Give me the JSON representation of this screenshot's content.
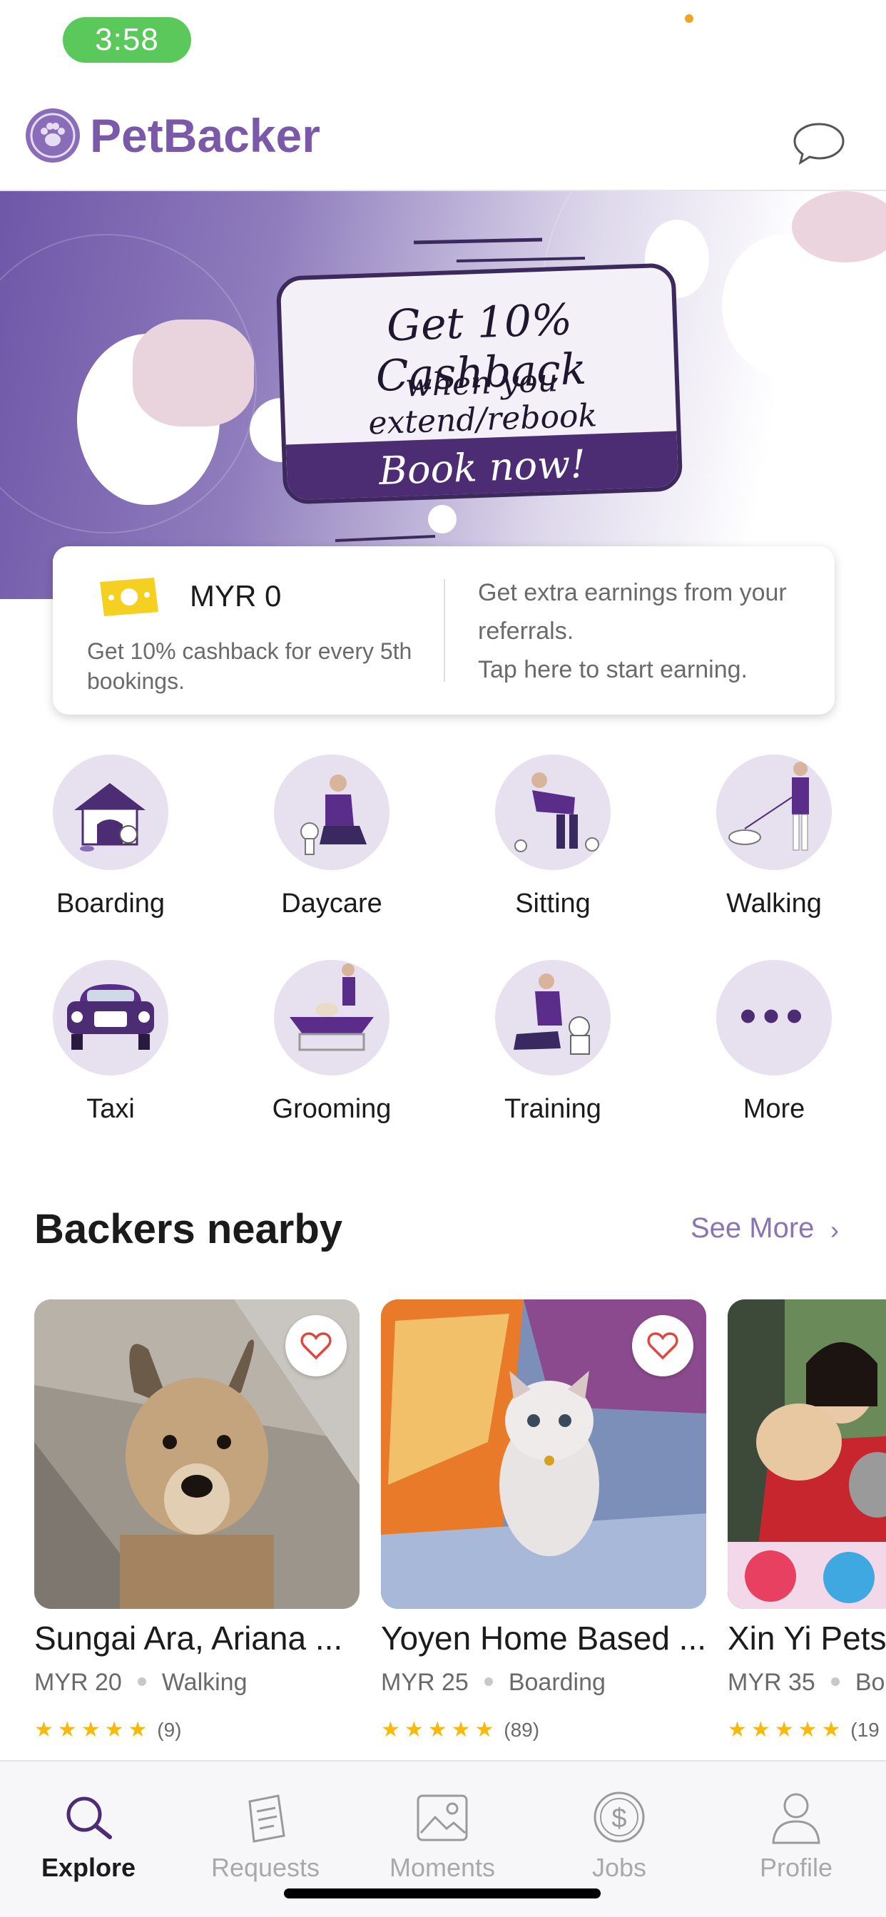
{
  "status": {
    "time": "3:58"
  },
  "header": {
    "app_name": "PetBacker",
    "logo_icon": "paw-logo-icon",
    "chat_icon": "chat-bubble-icon"
  },
  "banner": {
    "headline": "Get 10% Cashback",
    "subline": "when you extend/rebook",
    "cta": "Book now!"
  },
  "wallet": {
    "amount": "MYR 0",
    "description": "Get 10% cashback for every 5th bookings.",
    "referral": "Get extra earnings from your referrals.\nTap here to start earning."
  },
  "services": [
    {
      "label": "Boarding",
      "icon": "doghouse-icon"
    },
    {
      "label": "Daycare",
      "icon": "daycare-icon"
    },
    {
      "label": "Sitting",
      "icon": "sitting-icon"
    },
    {
      "label": "Walking",
      "icon": "walking-icon"
    },
    {
      "label": "Taxi",
      "icon": "car-icon"
    },
    {
      "label": "Grooming",
      "icon": "grooming-icon"
    },
    {
      "label": "Training",
      "icon": "training-icon"
    },
    {
      "label": "More",
      "icon": "more-dots-icon"
    }
  ],
  "backers_section": {
    "title": "Backers nearby",
    "see_more": "See More"
  },
  "backers": [
    {
      "name": "Sungai Ara, Ariana ...",
      "price": "MYR 20",
      "service": "Walking",
      "stars": "★★★★★",
      "reviews": "(9)"
    },
    {
      "name": "Yoyen Home Based ...",
      "price": "MYR 25",
      "service": "Boarding",
      "stars": "★★★★★",
      "reviews": "(89)"
    },
    {
      "name": "Xin Yi Pets",
      "price": "MYR 35",
      "service": "Bo",
      "stars": "★★★★★",
      "reviews": "(19"
    }
  ],
  "tabs": [
    {
      "label": "Explore",
      "icon": "search-icon",
      "active": true
    },
    {
      "label": "Requests",
      "icon": "document-icon",
      "active": false
    },
    {
      "label": "Moments",
      "icon": "image-icon",
      "active": false
    },
    {
      "label": "Jobs",
      "icon": "dollar-coin-icon",
      "active": false
    },
    {
      "label": "Profile",
      "icon": "person-icon",
      "active": false
    }
  ],
  "colors": {
    "brand_purple": "#7a5aa8",
    "status_green": "#5ac85a",
    "star_yellow": "#f6b90d",
    "cta_purple": "#4c2d73"
  }
}
